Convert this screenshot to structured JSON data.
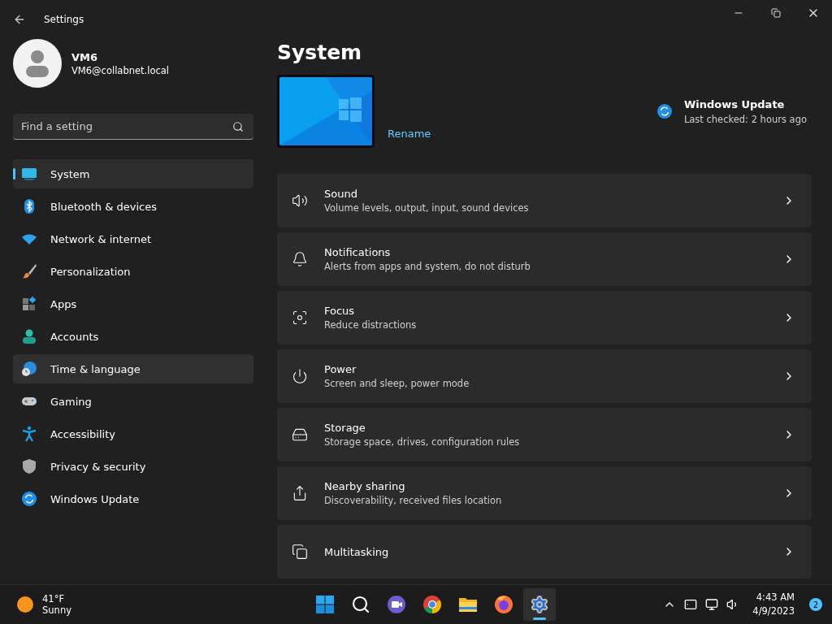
{
  "window": {
    "title": "Settings"
  },
  "account": {
    "name": "VM6",
    "email": "VM6@collabnet.local"
  },
  "search": {
    "placeholder": "Find a setting"
  },
  "nav": [
    {
      "label": "System",
      "kind": "system",
      "selected": true,
      "hovered": false
    },
    {
      "label": "Bluetooth & devices",
      "kind": "bluetooth",
      "selected": false,
      "hovered": false
    },
    {
      "label": "Network & internet",
      "kind": "wifi",
      "selected": false,
      "hovered": false
    },
    {
      "label": "Personalization",
      "kind": "brush",
      "selected": false,
      "hovered": false
    },
    {
      "label": "Apps",
      "kind": "apps",
      "selected": false,
      "hovered": false
    },
    {
      "label": "Accounts",
      "kind": "person",
      "selected": false,
      "hovered": false
    },
    {
      "label": "Time & language",
      "kind": "globe",
      "selected": false,
      "hovered": true
    },
    {
      "label": "Gaming",
      "kind": "gamepad",
      "selected": false,
      "hovered": false
    },
    {
      "label": "Accessibility",
      "kind": "access",
      "selected": false,
      "hovered": false
    },
    {
      "label": "Privacy & security",
      "kind": "shield",
      "selected": false,
      "hovered": false
    },
    {
      "label": "Windows Update",
      "kind": "update",
      "selected": false,
      "hovered": false
    }
  ],
  "page": {
    "title": "System",
    "rename": "Rename",
    "update": {
      "title": "Windows Update",
      "status": "Last checked: 2 hours ago"
    }
  },
  "cards": [
    {
      "title": "Sound",
      "subtitle": "Volume levels, output, input, sound devices",
      "kind": "sound"
    },
    {
      "title": "Notifications",
      "subtitle": "Alerts from apps and system, do not disturb",
      "kind": "bell"
    },
    {
      "title": "Focus",
      "subtitle": "Reduce distractions",
      "kind": "focus"
    },
    {
      "title": "Power",
      "subtitle": "Screen and sleep, power mode",
      "kind": "power"
    },
    {
      "title": "Storage",
      "subtitle": "Storage space, drives, configuration rules",
      "kind": "storage"
    },
    {
      "title": "Nearby sharing",
      "subtitle": "Discoverability, received files location",
      "kind": "share"
    },
    {
      "title": "Multitasking",
      "kind": "multi"
    }
  ],
  "taskbar": {
    "weather": {
      "temp": "41°F",
      "condition": "Sunny"
    },
    "apps": [
      {
        "kind": "start",
        "active": false
      },
      {
        "kind": "search",
        "active": false
      },
      {
        "kind": "chat",
        "active": false
      },
      {
        "kind": "chrome",
        "active": false
      },
      {
        "kind": "folder",
        "active": false
      },
      {
        "kind": "firefox",
        "active": false
      },
      {
        "kind": "settings",
        "active": true
      }
    ],
    "time": "4:43 AM",
    "date": "4/9/2023",
    "badge": "2"
  }
}
